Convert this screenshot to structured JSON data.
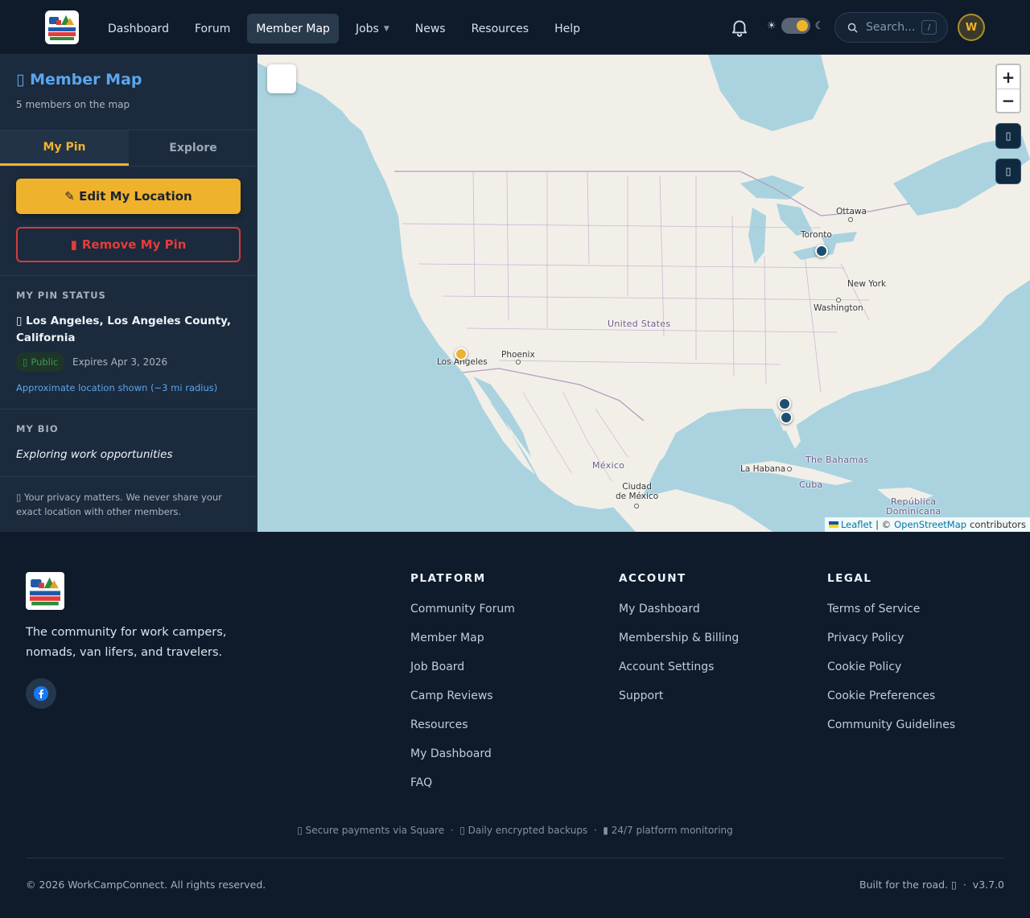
{
  "nav": {
    "links": [
      "Dashboard",
      "Forum",
      "Member Map",
      "Jobs",
      "News",
      "Resources",
      "Help"
    ],
    "active": "Member Map",
    "theme_sun": "☀",
    "theme_moon": "☾",
    "search_placeholder": "Search...",
    "search_shortcut": "/",
    "avatar_initial": "W"
  },
  "sidebar": {
    "title": "Member Map",
    "title_icon": "map-icon",
    "member_count": "5 members on the map",
    "tabs": [
      "My Pin",
      "Explore"
    ],
    "active_tab": "My Pin",
    "edit_button": "✎ Edit My Location",
    "remove_button": "Remove My Pin",
    "status_heading": "MY PIN STATUS",
    "location": "Los Angeles, Los Angeles County, California",
    "visibility": "Public",
    "expires": "Expires Apr 3, 2026",
    "approx": "Approximate location shown (~3 mi radius)",
    "bio_heading": "MY BIO",
    "bio": "Exploring work opportunities",
    "privacy": "Your privacy matters. We never share your exact location with other members."
  },
  "map": {
    "labels": {
      "ottawa": "Ottawa",
      "toronto": "Toronto",
      "new_york": "New York",
      "washington": "Washington",
      "united_states": "United States",
      "phoenix": "Phoenix",
      "los_angeles": "Los Angeles",
      "mexico": "México",
      "mexico_city": "Ciudad\nde México",
      "la_habana": "La Habana",
      "bahamas": "The Bahamas",
      "cuba": "Cuba",
      "dominicana": "República\nDominicana"
    },
    "zoom_in": "+",
    "zoom_out": "−",
    "attribution": {
      "leaflet": "Leaflet",
      "sep": "| ©",
      "osm": "OpenStreetMap",
      "contributors": "contributors"
    }
  },
  "footer": {
    "tagline": "The community for work campers, nomads, van lifers, and travelers.",
    "columns": [
      {
        "title": "PLATFORM",
        "links": [
          "Community Forum",
          "Member Map",
          "Job Board",
          "Camp Reviews",
          "Resources",
          "My Dashboard",
          "FAQ"
        ]
      },
      {
        "title": "ACCOUNT",
        "links": [
          "My Dashboard",
          "Membership & Billing",
          "Account Settings",
          "Support"
        ]
      },
      {
        "title": "LEGAL",
        "links": [
          "Terms of Service",
          "Privacy Policy",
          "Cookie Policy",
          "Cookie Preferences",
          "Community Guidelines"
        ]
      }
    ],
    "trust": [
      "Secure payments via Square",
      "Daily encrypted backups",
      "24/7 platform monitoring"
    ],
    "copyright": "© 2026 WorkCampConnect. All rights reserved.",
    "built": "Built for the road.",
    "version": "v3.7.0"
  },
  "colors": {
    "accent": "#efb22c",
    "danger": "#e23c3c",
    "link": "#5ba6ee",
    "bg": "#0f1b2b"
  }
}
